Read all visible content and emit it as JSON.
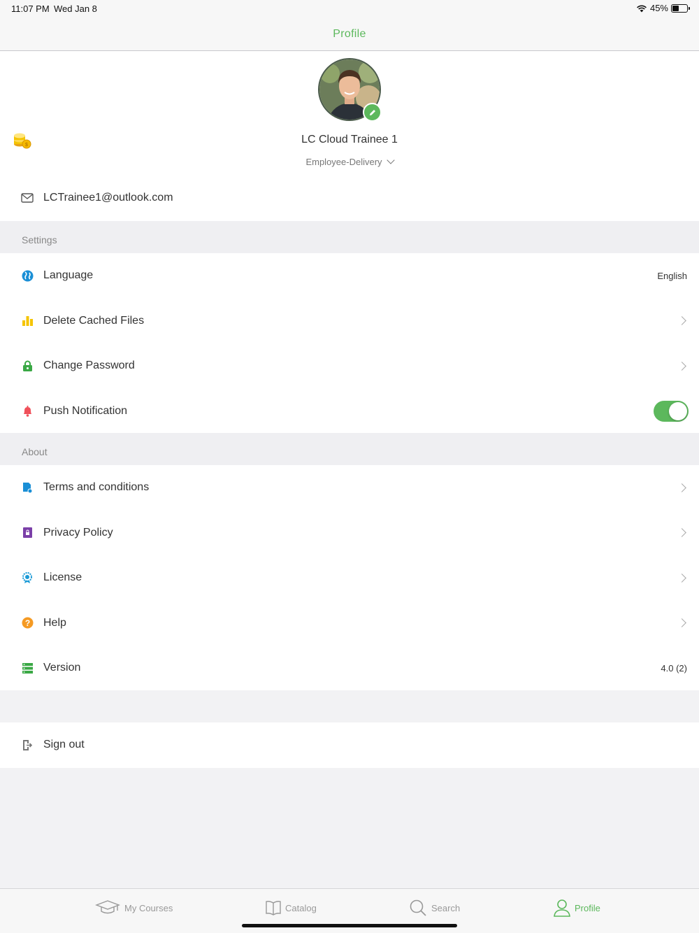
{
  "status_bar": {
    "time": "11:07 PM",
    "date": "Wed Jan 8",
    "battery": "45%"
  },
  "nav": {
    "title": "Profile"
  },
  "profile": {
    "name": "LC Cloud Trainee 1",
    "department": "Employee-Delivery",
    "email": "LCTrainee1@outlook.com"
  },
  "settings": {
    "header": "Settings",
    "items": [
      {
        "label": "Language",
        "value": "English",
        "icon": "globe-icon"
      },
      {
        "label": "Delete Cached Files",
        "icon": "bar-chart-icon"
      },
      {
        "label": "Change Password",
        "icon": "lock-icon"
      },
      {
        "label": "Push Notification",
        "icon": "bell-icon",
        "toggle_on": true
      }
    ]
  },
  "about": {
    "header": "About",
    "items": [
      {
        "label": "Terms and conditions",
        "icon": "document-icon"
      },
      {
        "label": "Privacy Policy",
        "icon": "privacy-icon"
      },
      {
        "label": "License",
        "icon": "badge-icon"
      },
      {
        "label": "Help",
        "icon": "help-icon"
      },
      {
        "label": "Version",
        "value": "4.0 (2)",
        "icon": "server-icon"
      }
    ]
  },
  "signout": {
    "label": "Sign out"
  },
  "tabs": [
    {
      "label": "My Courses",
      "icon": "graduation-cap-icon"
    },
    {
      "label": "Catalog",
      "icon": "book-icon"
    },
    {
      "label": "Search",
      "icon": "search-icon"
    },
    {
      "label": "Profile",
      "icon": "person-icon",
      "active": true
    }
  ],
  "colors": {
    "accent": "#5cb85c",
    "background": "#f2f2f4",
    "section": "#efeff2"
  }
}
